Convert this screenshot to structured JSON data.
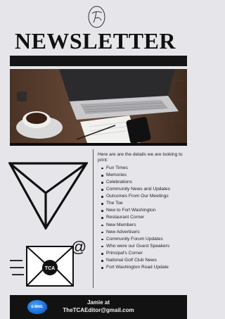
{
  "header": {
    "logo_text": "TCA",
    "title": "NEWSLETTER"
  },
  "photo": {
    "icon": "laptop-coffee-photo"
  },
  "content": {
    "intro": "Here are are the details we are looking to print:",
    "items": [
      "Fun Times",
      "Memories",
      "Celebrations",
      "Community News and Updates",
      "Outcomes From Our Meetings",
      "The Toe",
      "New to Fort Washington",
      "Restaurant Corner",
      "New Members",
      "New Advertisers",
      "Community Forum Updates",
      "Who were our Guest Speakers",
      "Principal's Corner",
      "National Golf Club News",
      "Fort Washington Road Update"
    ]
  },
  "illustration": {
    "plane_icon": "paper-plane-icon",
    "mail_icon": "envelope-icon",
    "envelope_label": "TCA",
    "at_symbol": "@"
  },
  "footer": {
    "badge": "E-MAIL",
    "name": "Jamie at",
    "email": "TheTCAEditor@gmail.com"
  },
  "colors": {
    "background": "#e6e6ea",
    "bar": "#151515",
    "badge": "#1f78e0"
  }
}
